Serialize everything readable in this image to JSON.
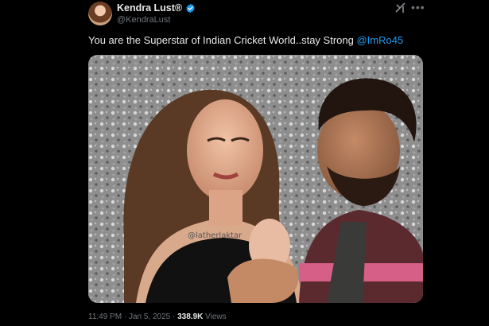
{
  "author": {
    "display_name": "Kendra Lust®",
    "handle": "@KendraLust",
    "verified": true,
    "verified_color": "#1d9bf0"
  },
  "tweet": {
    "text": "You are the Superstar of Indian Cricket World..stay Strong ",
    "mention": "@ImRo45",
    "mention_color": "#1d9bf0"
  },
  "media": {
    "watermark": "@latherlaktar"
  },
  "meta": {
    "time": "11:49 PM",
    "separator1": " · ",
    "date": "Jan 5, 2025",
    "separator2": " · ",
    "views_count": "338.9K",
    "views_label": " Views"
  },
  "icons": {
    "top_right": [
      "grok-icon",
      "more-icon"
    ]
  }
}
